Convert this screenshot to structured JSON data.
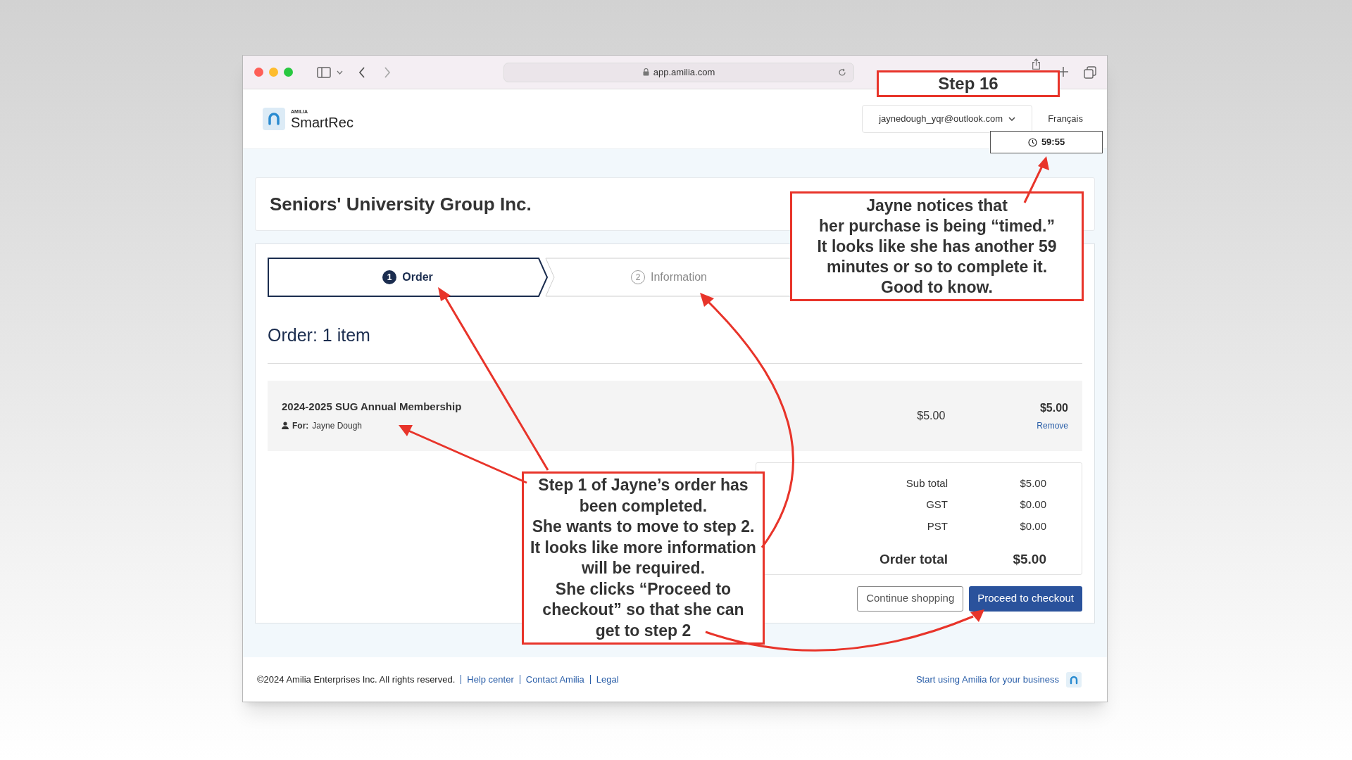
{
  "browser": {
    "address": "app.amilia.com"
  },
  "header": {
    "brand_small": "AMILIA",
    "brand": "SmartRec",
    "account": "jaynedough_yqr@outlook.com",
    "language": "Français",
    "timer": "59:55"
  },
  "organization": "Seniors' University Group Inc.",
  "steps": [
    {
      "number": "1",
      "label": "Order",
      "selected": true
    },
    {
      "number": "2",
      "label": "Information",
      "selected": false
    }
  ],
  "order": {
    "heading": "Order: 1 item",
    "item": {
      "name": "2024-2025 SUG Annual Membership",
      "for_label": "For:",
      "for_name": "Jayne Dough",
      "unit_price": "$5.00",
      "total": "$5.00",
      "remove": "Remove"
    },
    "totals": [
      {
        "label": "Sub total",
        "value": "$5.00",
        "kind": "line"
      },
      {
        "label": "GST",
        "value": "$0.00",
        "kind": "line"
      },
      {
        "label": "PST",
        "value": "$0.00",
        "kind": "line"
      },
      {
        "label": "Order total",
        "value": "$5.00",
        "kind": "grand"
      }
    ],
    "buttons": [
      {
        "label": "Continue shopping",
        "kind": "secondary"
      },
      {
        "label": "Proceed to checkout",
        "kind": "primary"
      }
    ]
  },
  "footer": {
    "copyright": "©2024 Amilia Enterprises Inc. All rights reserved.",
    "links": [
      "Help center",
      "Contact Amilia",
      "Legal"
    ],
    "promo": "Start using Amilia for your business"
  },
  "annotations": [
    {
      "kind": "title",
      "text": "Step 16"
    },
    {
      "kind": "note",
      "text": "Jayne notices that\nher purchase is being “timed.”\nIt looks like she has another 59\nminutes or so to complete it.\nGood to know."
    },
    {
      "kind": "note",
      "text": "Step 1 of Jayne’s order has\nbeen completed.\nShe wants to move to step 2.\nIt looks like more information\nwill be required.\nShe clicks “Proceed to\ncheckout” so that she can\nget to step 2"
    }
  ]
}
